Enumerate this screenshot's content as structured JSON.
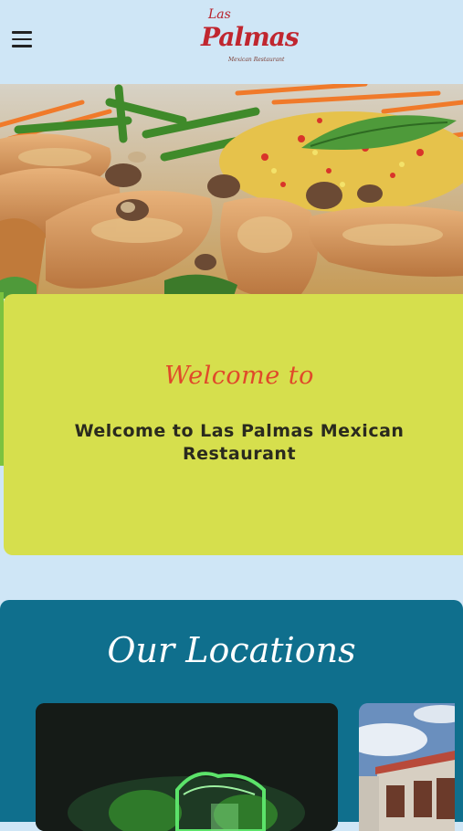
{
  "header": {
    "menu_icon": "hamburger-menu-icon",
    "logo": {
      "line1": "Las",
      "line2": "Palmas",
      "tagline": "Mexican Restaurant"
    }
  },
  "hero": {
    "image": "food-dish-photo"
  },
  "welcome": {
    "script_heading": "Welcome to",
    "title": "Welcome to Las Palmas Mexican Restaurant"
  },
  "locations": {
    "heading": "Our Locations",
    "cards": [
      {
        "image": "restaurant-neon-sign-photo"
      },
      {
        "image": "restaurant-building-photo"
      }
    ]
  },
  "colors": {
    "header_bg": "#cfe6f6",
    "welcome_card": "#d6df4d",
    "welcome_script": "#e0492a",
    "locations_bg": "#0f6f8d",
    "logo_red": "#c0262f"
  }
}
